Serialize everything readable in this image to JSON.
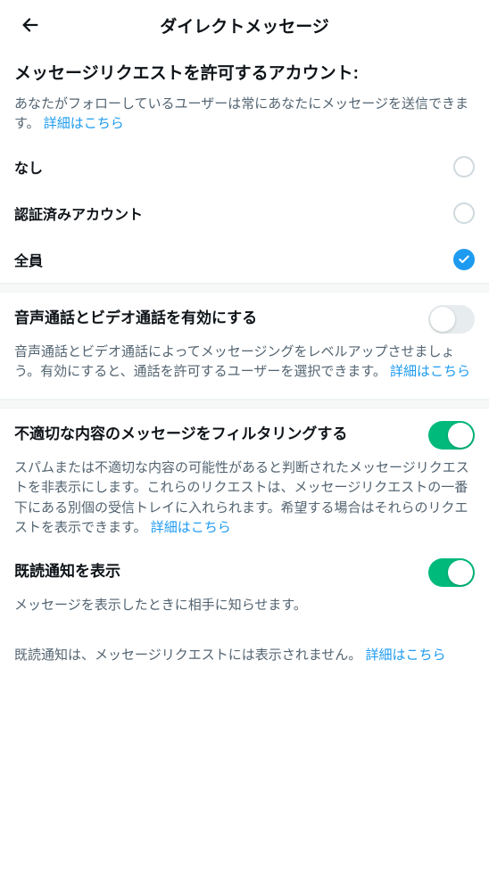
{
  "header": {
    "title": "ダイレクトメッセージ"
  },
  "allowRequests": {
    "title": "メッセージリクエストを許可するアカウント:",
    "desc": "あなたがフォローしているユーザーは常にあなたにメッセージを送信できます。",
    "link": "詳細はこちら",
    "options": [
      {
        "label": "なし",
        "selected": false
      },
      {
        "label": "認証済みアカウント",
        "selected": false
      },
      {
        "label": "全員",
        "selected": true
      }
    ]
  },
  "calls": {
    "title": "音声通話とビデオ通話を有効にする",
    "desc": "音声通話とビデオ通話によってメッセージングをレベルアップさせましょう。有効にすると、通話を許可するユーザーを選択できます。",
    "link": "詳細はこちら",
    "enabled": false
  },
  "filter": {
    "title": "不適切な内容のメッセージをフィルタリングする",
    "desc": "スパムまたは不適切な内容の可能性があると判断されたメッセージリクエストを非表示にします。これらのリクエストは、メッセージリクエストの一番下にある別個の受信トレイに入れられます。希望する場合はそれらのリクエストを表示できます。",
    "link": "詳細はこちら",
    "enabled": true
  },
  "readReceipts": {
    "title": "既読通知を表示",
    "desc": "メッセージを表示したときに相手に知らせます。",
    "note": "既読通知は、メッセージリクエストには表示されません。",
    "link": "詳細はこちら",
    "enabled": true
  }
}
